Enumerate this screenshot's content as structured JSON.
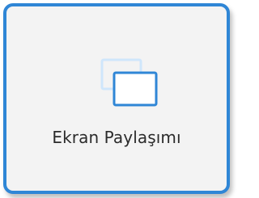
{
  "tile": {
    "label": "Ekran Paylaşımı",
    "icon": "screen-share-icon"
  },
  "colors": {
    "accent": "#2f86d6",
    "tile_background": "#f3f3f3",
    "icon_back_window": "#cfe6fb",
    "text": "#2b2b2b"
  }
}
